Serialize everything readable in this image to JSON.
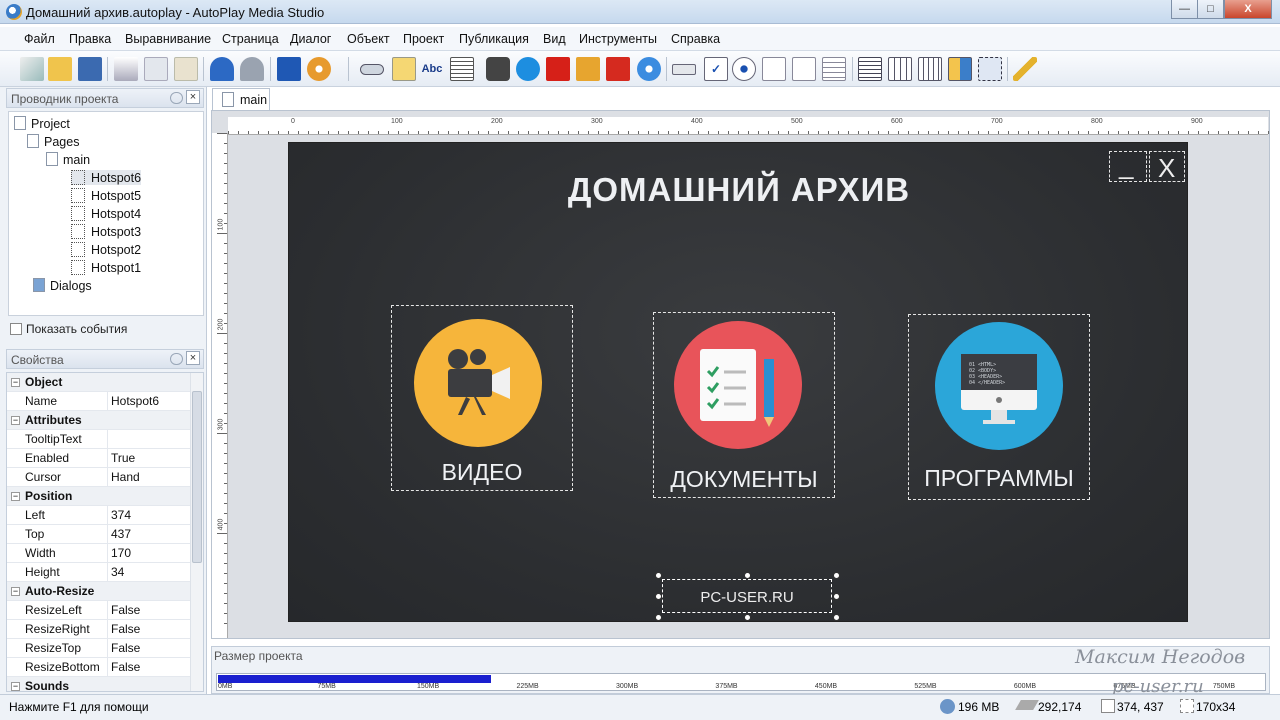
{
  "window": {
    "title": "Домашний архив.autoplay - AutoPlay Media Studio",
    "min": "—",
    "max": "□",
    "close": "X"
  },
  "menu": [
    "Файл",
    "Правка",
    "Выравнивание",
    "Страница",
    "Диалог",
    "Объект",
    "Проект",
    "Публикация",
    "Вид",
    "Инструменты",
    "Справка"
  ],
  "explorer": {
    "title": "Проводник проекта",
    "tree": {
      "root": "Project",
      "pages": "Pages",
      "page": "main",
      "hotspots": [
        "Hotspot6",
        "Hotspot5",
        "Hotspot4",
        "Hotspot3",
        "Hotspot2",
        "Hotspot1"
      ],
      "dialogs": "Dialogs"
    },
    "show_events": "Показать события"
  },
  "properties": {
    "title": "Свойства",
    "rows": [
      {
        "cat": "Object"
      },
      {
        "k": "Name",
        "v": "Hotspot6"
      },
      {
        "cat": "Attributes"
      },
      {
        "k": "TooltipText",
        "v": ""
      },
      {
        "k": "Enabled",
        "v": "True"
      },
      {
        "k": "Cursor",
        "v": "Hand"
      },
      {
        "cat": "Position"
      },
      {
        "k": "Left",
        "v": "374"
      },
      {
        "k": "Top",
        "v": "437"
      },
      {
        "k": "Width",
        "v": "170"
      },
      {
        "k": "Height",
        "v": "34"
      },
      {
        "cat": "Auto-Resize"
      },
      {
        "k": "ResizeLeft",
        "v": "False"
      },
      {
        "k": "ResizeRight",
        "v": "False"
      },
      {
        "k": "ResizeTop",
        "v": "False"
      },
      {
        "k": "ResizeBottom",
        "v": "False"
      },
      {
        "cat": "Sounds"
      }
    ]
  },
  "doc_tab": "main",
  "ruler": {
    "h": [
      "0",
      "100",
      "200",
      "300",
      "400",
      "500",
      "600",
      "700",
      "800",
      "900"
    ],
    "v": [
      "100",
      "200",
      "300",
      "400"
    ]
  },
  "canvas": {
    "title": "ДОМАШНИЙ АРХИВ",
    "tiles": [
      {
        "label": "ВИДЕО",
        "icon": "video-camera-icon",
        "color": "#f6b53b"
      },
      {
        "label": "ДОКУМЕНТЫ",
        "icon": "documents-icon",
        "color": "#e8545a"
      },
      {
        "label": "ПРОГРАММЫ",
        "icon": "monitor-code-icon",
        "color": "#2ba6d9"
      }
    ],
    "code_lines": [
      "01 <HTML>",
      "02 <BODY>",
      "03 <HEADER>",
      "04 </HEADER>"
    ],
    "site": "PC-USER.RU",
    "ctrl_min": "_",
    "ctrl_close": "X"
  },
  "size_panel": {
    "title": "Размер проекта",
    "marks": [
      "0MB",
      "75MB",
      "150MB",
      "225MB",
      "300MB",
      "375MB",
      "450MB",
      "525MB",
      "600MB",
      "675MB",
      "750MB"
    ],
    "fill_fraction": 0.26
  },
  "status": {
    "help": "Нажмите F1 для помощи",
    "size": "196 MB",
    "coords": "292,174",
    "pos": "374, 437",
    "dim": "170x34"
  },
  "watermark": {
    "author": "Максим Негодов",
    "site": "pc-user.ru"
  }
}
